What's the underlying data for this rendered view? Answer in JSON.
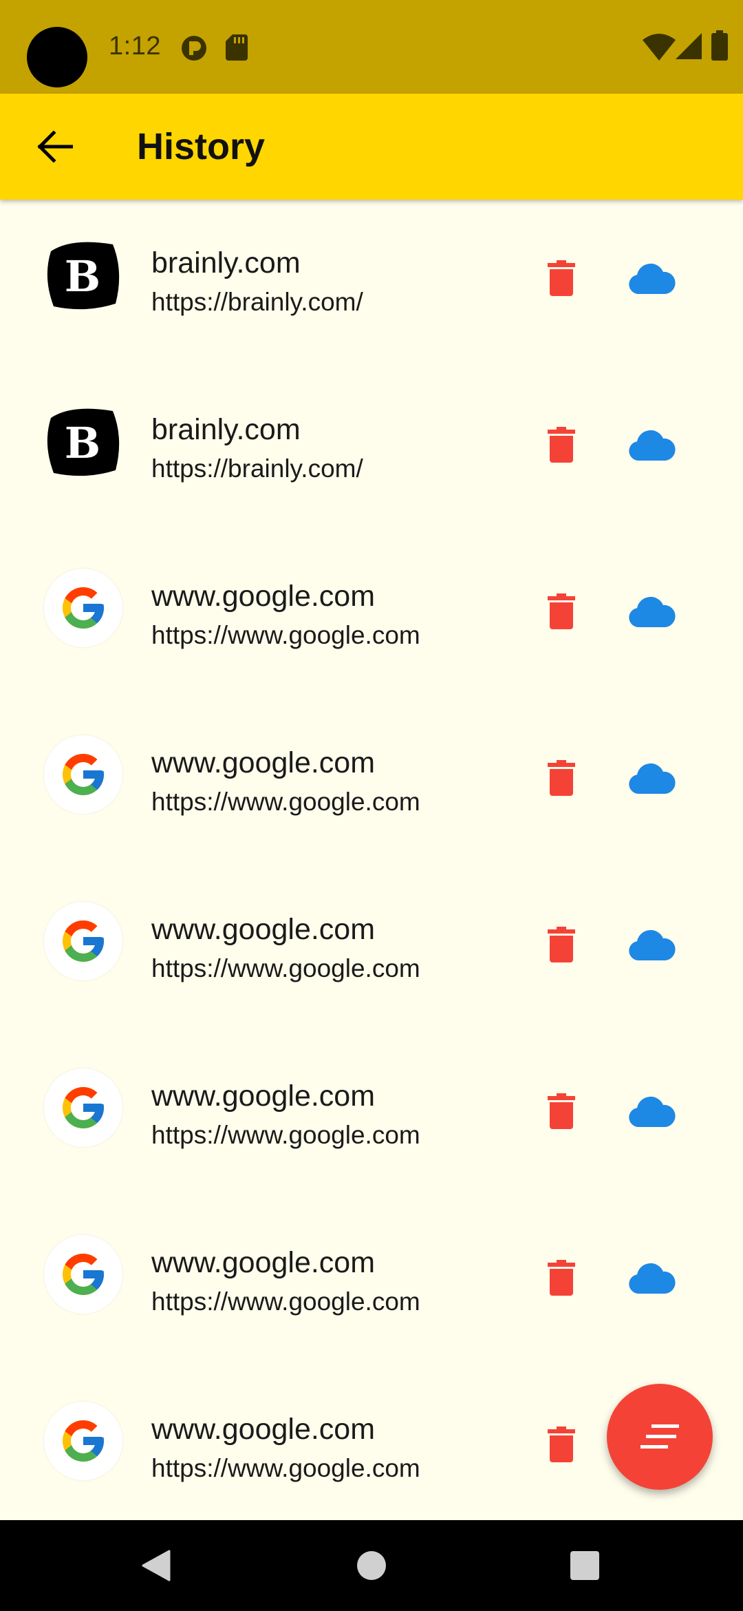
{
  "status_bar": {
    "time": "1:12",
    "icons": [
      "notification-app-icon",
      "sd-card-icon",
      "wifi-icon",
      "signal-icon",
      "battery-icon"
    ]
  },
  "app_bar": {
    "back_icon": "arrow-left-icon",
    "title": "History",
    "color": "#FFD600"
  },
  "history": [
    {
      "icon": "brainly-logo",
      "title": "brainly.com",
      "url": "https://brainly.com/"
    },
    {
      "icon": "brainly-logo",
      "title": "brainly.com",
      "url": "https://brainly.com/"
    },
    {
      "icon": "google-logo",
      "title": "www.google.com",
      "url": "https://www.google.com"
    },
    {
      "icon": "google-logo",
      "title": "www.google.com",
      "url": "https://www.google.com"
    },
    {
      "icon": "google-logo",
      "title": "www.google.com",
      "url": "https://www.google.com"
    },
    {
      "icon": "google-logo",
      "title": "www.google.com",
      "url": "https://www.google.com"
    },
    {
      "icon": "google-logo",
      "title": "www.google.com",
      "url": "https://www.google.com"
    },
    {
      "icon": "google-logo",
      "title": "www.google.com",
      "url": "https://www.google.com"
    }
  ],
  "row_actions": {
    "delete_icon": "trash-icon",
    "delete_color": "#F44336",
    "cloud_icon": "cloud-icon",
    "cloud_color": "#1E88E5"
  },
  "fab": {
    "icon": "sort-lines-icon",
    "color": "#F44336"
  },
  "nav_bar": {
    "buttons": [
      "back-triangle-icon",
      "home-circle-icon",
      "recents-square-icon"
    ]
  }
}
